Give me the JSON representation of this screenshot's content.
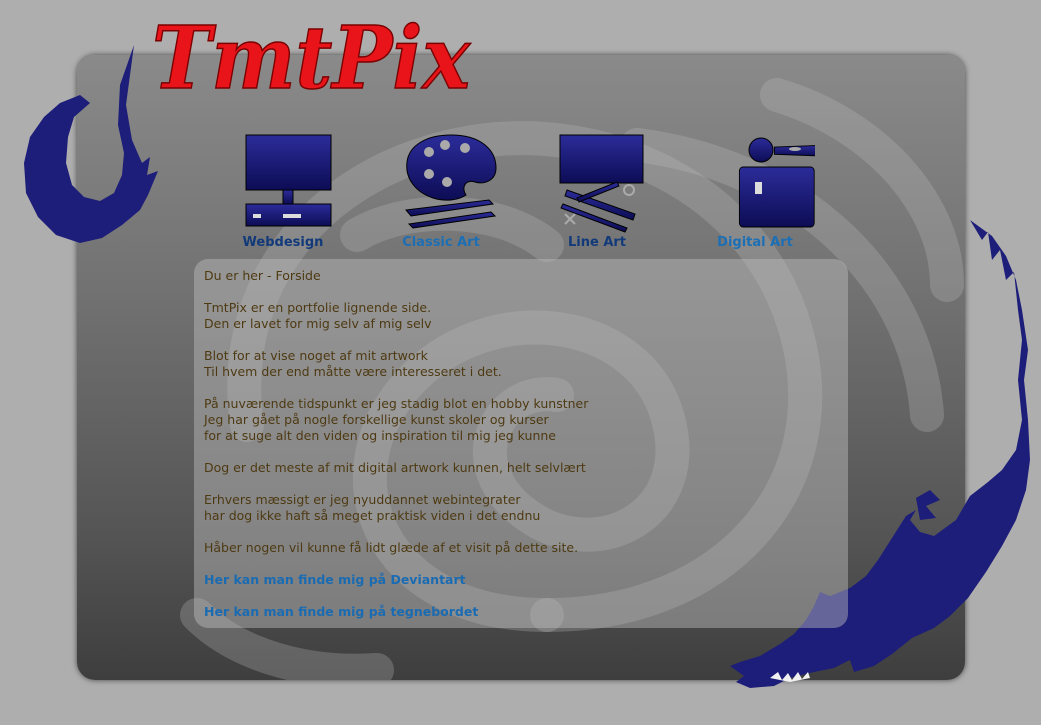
{
  "site": {
    "logo_text": "TmtPix"
  },
  "nav": [
    {
      "label": "Webdesign",
      "icon": "monitor-icon",
      "color": "#123a7a"
    },
    {
      "label": "Classic Art",
      "icon": "palette-icon",
      "color": "#1c6fb5"
    },
    {
      "label": "Line Art",
      "icon": "easel-icon",
      "color": "#123a7a"
    },
    {
      "label": "Digital Art",
      "icon": "tablet-icon",
      "color": "#1c6fb5"
    }
  ],
  "content": {
    "breadcrumb": "Du er her - Forside",
    "paragraphs": [
      [
        "TmtPix er en portfolie lignende side.",
        "Den er lavet for mig selv af mig selv"
      ],
      [
        "Blot for at vise noget af mit artwork",
        "Til hvem der end måtte være interesseret i det."
      ],
      [
        "På nuværende tidspunkt er jeg stadig blot en hobby kunstner",
        "Jeg har gået på nogle forskellige kunst skoler og kurser",
        "for at suge alt den viden og inspiration til mig jeg kunne"
      ],
      [
        "Dog er det meste af mit digital artwork kunnen, helt selvlært"
      ],
      [
        "Erhvers mæssigt er jeg nyuddannet webintegrater",
        "har dog ikke haft så meget praktisk viden i det endnu"
      ],
      [
        "Håber nogen vil kunne få lidt glæde af et visit på dette site."
      ]
    ],
    "links": [
      "Her kan man finde mig på Deviantart",
      "Her kan man finde mig på tegnebordet"
    ]
  },
  "colors": {
    "background": "#aeaeae",
    "dragon": "#1d1d7a",
    "logo": "#e8141a",
    "text": "#4e3a12",
    "link": "#1a6bb2"
  }
}
